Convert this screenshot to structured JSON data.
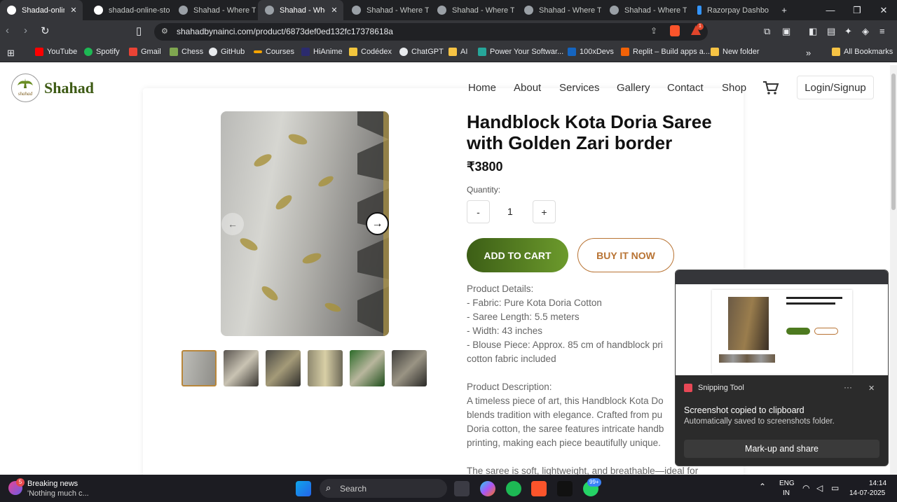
{
  "tabs": [
    {
      "title": "Shadad-onlin",
      "active": true
    },
    {
      "title": "shadad-online-sto",
      "active": false
    },
    {
      "title": "Shahad - Where Tr",
      "active": false
    },
    {
      "title": "Shahad - Whe",
      "active": true
    },
    {
      "title": "Shahad - Where Tr",
      "active": false
    },
    {
      "title": "Shahad - Where Tr",
      "active": false
    },
    {
      "title": "Shahad - Where Tr",
      "active": false
    },
    {
      "title": "Shahad - Where Tr",
      "active": false
    },
    {
      "title": "Razorpay Dashbo",
      "active": false
    }
  ],
  "address": {
    "url": "shahadbynainci.com/product/6873def0ed132fc17378618a",
    "brave_badge": "1"
  },
  "bookmarks": [
    "YouTube",
    "Spotify",
    "Gmail",
    "Chess",
    "GitHub",
    "Courses",
    "HiAnime",
    "Codédex",
    "ChatGPT",
    "AI",
    "Power Your Softwar...",
    "100xDevs",
    "Replit – Build apps a...",
    "New folder",
    "All Bookmarks"
  ],
  "site": {
    "brand": "Shahad",
    "nav": [
      "Home",
      "About",
      "Services",
      "Gallery",
      "Contact",
      "Shop"
    ],
    "login": "Login/Signup"
  },
  "product": {
    "title": "Handblock Kota Doria Saree with Golden Zari border",
    "price": "₹3800",
    "quantity_label": "Quantity:",
    "qty_minus": "-",
    "quantity": "1",
    "qty_plus": "+",
    "add_to_cart": "ADD TO CART",
    "buy_now": "BUY IT NOW",
    "details_lines": [
      "Product Details:",
      "- Fabric: Pure Kota Doria Cotton",
      "- Saree Length: 5.5 meters",
      "- Width: 43 inches",
      "- Blouse Piece: Approx. 85 cm of handblock pri",
      "cotton fabric included",
      "",
      "Product Description:",
      "A timeless piece of art, this Handblock Kota Do",
      "blends tradition with elegance. Crafted from pu",
      "Doria cotton, the saree features intricate handb",
      "printing, making each piece beautifully unique.",
      "",
      "The saree is soft, lightweight, and breathable—ideal for"
    ]
  },
  "snipping": {
    "app": "Snipping Tool",
    "message": "Screenshot copied to clipboard",
    "sub": "Automatically saved to screenshots folder.",
    "action": "Mark-up and share",
    "more": "···",
    "close": "✕"
  },
  "taskbar": {
    "news_title": "Breaking news",
    "news_sub": "'Nothing much c...",
    "news_badge": "5",
    "search": "Search",
    "whatsapp_badge": "99+",
    "lang1": "ENG",
    "lang2": "IN",
    "time": "14:14",
    "date": "14-07-2025"
  }
}
